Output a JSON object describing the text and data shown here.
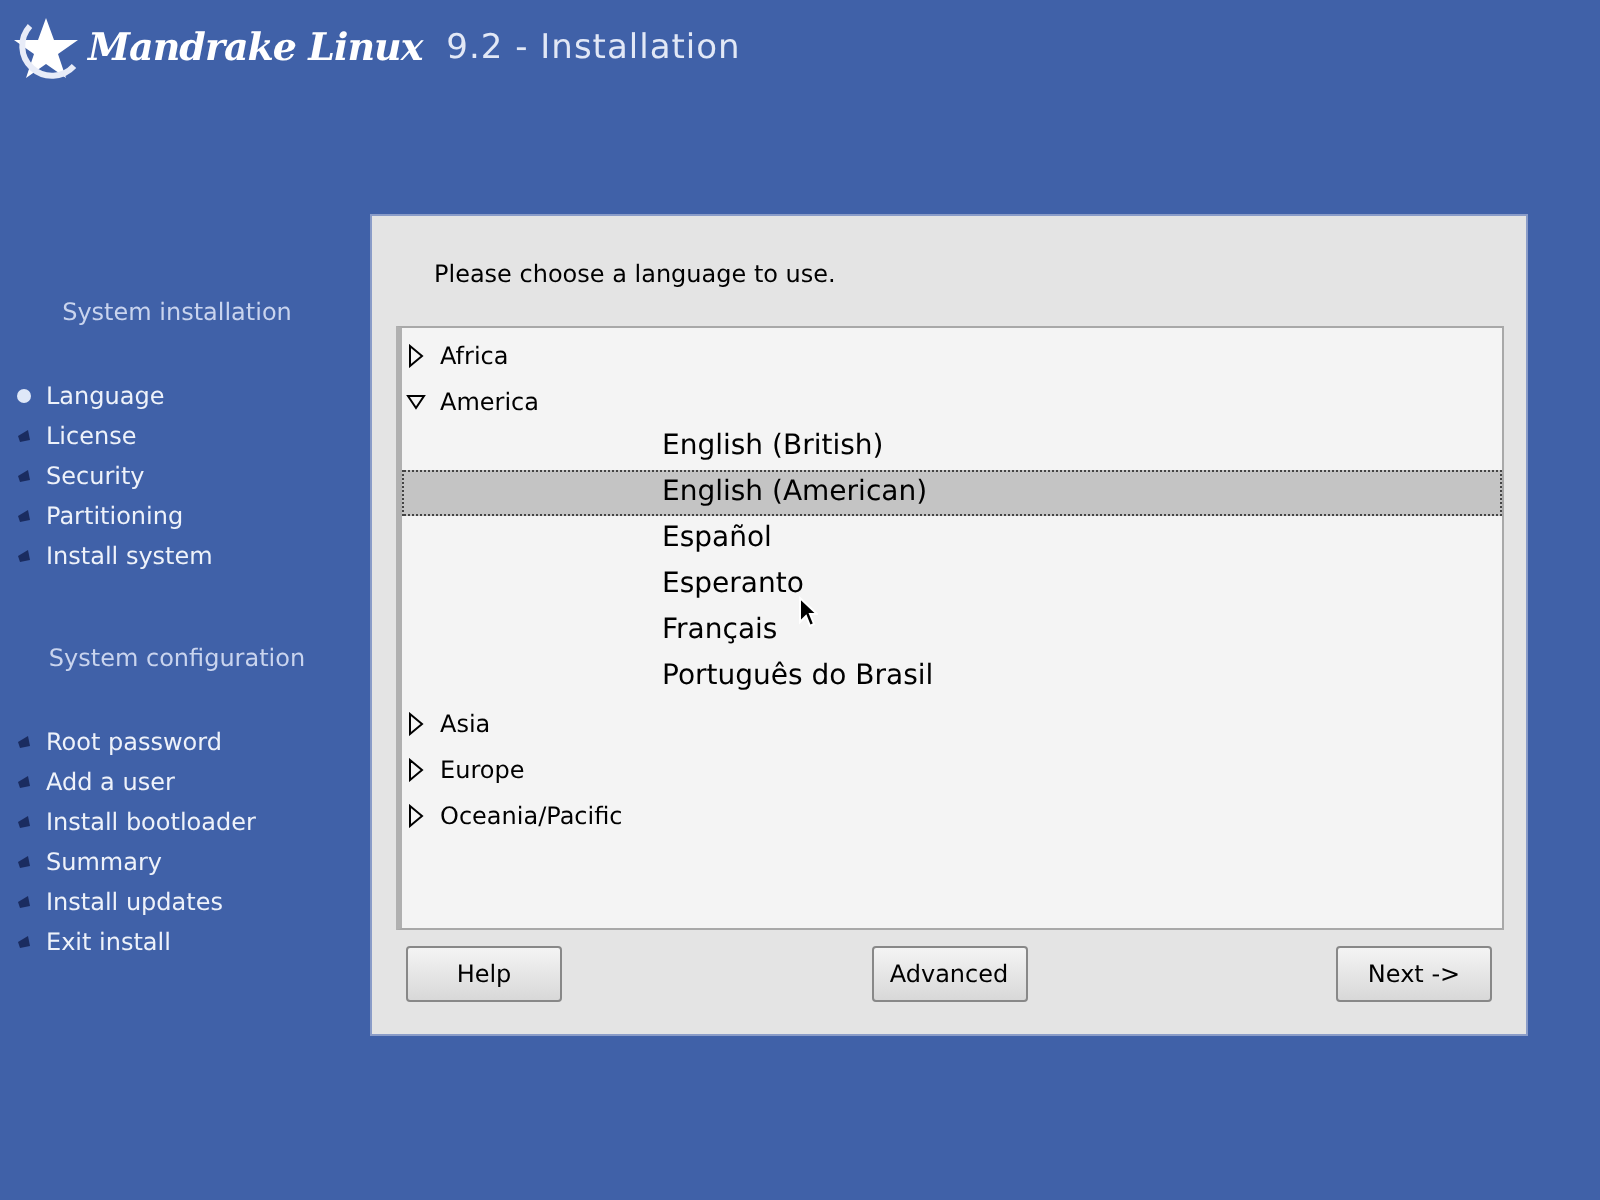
{
  "header": {
    "brand": "Mandrake Linux",
    "title": "9.2 - Installation"
  },
  "sidebar": [
    {
      "title": "System installation",
      "items": [
        {
          "label": "Language",
          "selected": true
        },
        {
          "label": "License",
          "selected": false
        },
        {
          "label": "Security",
          "selected": false
        },
        {
          "label": "Partitioning",
          "selected": false
        },
        {
          "label": "Install system",
          "selected": false
        }
      ]
    },
    {
      "title": "System configuration",
      "items": [
        {
          "label": "Root password",
          "selected": false
        },
        {
          "label": "Add a user",
          "selected": false
        },
        {
          "label": "Install bootloader",
          "selected": false
        },
        {
          "label": "Summary",
          "selected": false
        },
        {
          "label": "Install updates",
          "selected": false
        },
        {
          "label": "Exit install",
          "selected": false
        }
      ]
    }
  ],
  "prompt": "Please choose a language to use.",
  "tree": [
    {
      "label": "Africa",
      "expanded": false
    },
    {
      "label": "America",
      "expanded": true,
      "children": [
        {
          "label": "English (British)",
          "selected": false
        },
        {
          "label": "English (American)",
          "selected": true
        },
        {
          "label": "Español",
          "selected": false
        },
        {
          "label": "Esperanto",
          "selected": false
        },
        {
          "label": "Français",
          "selected": false
        },
        {
          "label": "Português do Brasil",
          "selected": false
        }
      ]
    },
    {
      "label": "Asia",
      "expanded": false
    },
    {
      "label": "Europe",
      "expanded": false
    },
    {
      "label": "Oceania/Pacific",
      "expanded": false
    }
  ],
  "buttons": [
    {
      "label": "Help"
    },
    {
      "label": "Advanced"
    },
    {
      "label": "Next ->"
    }
  ]
}
